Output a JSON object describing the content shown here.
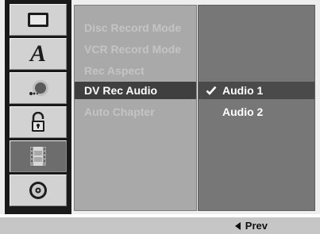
{
  "sidebar": {
    "icons": [
      {
        "name": "tv-screen-icon",
        "selected": false
      },
      {
        "name": "language-icon",
        "selected": false
      },
      {
        "name": "audio-icon",
        "selected": false
      },
      {
        "name": "lock-icon",
        "selected": false
      },
      {
        "name": "recording-film-icon",
        "selected": true
      },
      {
        "name": "disc-icon",
        "selected": false
      }
    ],
    "language_glyph": "A"
  },
  "submenu": {
    "items": [
      {
        "label": "Disc Record Mode"
      },
      {
        "label": "VCR Record Mode"
      },
      {
        "label": "Rec Aspect"
      },
      {
        "label": "DV Rec Audio"
      },
      {
        "label": "Auto Chapter"
      }
    ],
    "selected_index": 3
  },
  "options": {
    "items": [
      {
        "label": "Audio 1",
        "checked": true
      },
      {
        "label": "Audio 2",
        "checked": false
      }
    ]
  },
  "footer": {
    "prev_label": "Prev",
    "prev_icon": "left-triangle-icon"
  },
  "colors": {
    "panel_bg": "#eeeeee",
    "icon_column_bg": "#1a1a1a",
    "submenu_bg": "#a9a9a9",
    "submenu_selected_bg": "#3f3f3f",
    "options_bg": "#777777",
    "bottom_bar_bg": "#c6c6c6"
  }
}
